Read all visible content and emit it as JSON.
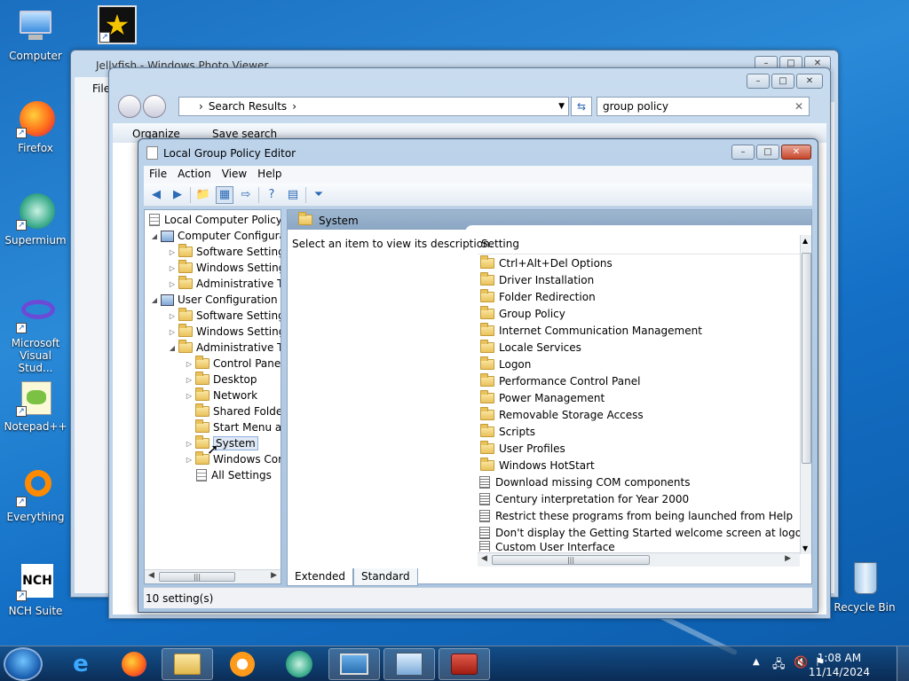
{
  "desktop": {
    "icons": [
      {
        "label": "Computer"
      },
      {
        "label": "Firefox"
      },
      {
        "label": "Supermium"
      },
      {
        "label": "Microsoft Visual Stud..."
      },
      {
        "label": "Notepad++"
      },
      {
        "label": "Everything"
      },
      {
        "label": "NCH Suite"
      },
      {
        "label": "Recycle Bin"
      }
    ]
  },
  "photo_viewer": {
    "title": "Jellyfish - Windows Photo Viewer",
    "menu_file": "File"
  },
  "explorer": {
    "breadcrumb": "Search Results",
    "search_value": "group policy",
    "organize": "Organize",
    "save_search": "Save search"
  },
  "gpe": {
    "title": "Local Group Policy Editor",
    "menu": [
      "File",
      "Action",
      "View",
      "Help"
    ],
    "tree": [
      {
        "label": "Local Computer Policy"
      },
      {
        "label": "Computer Configura"
      },
      {
        "label": "Software Settings"
      },
      {
        "label": "Windows Setting"
      },
      {
        "label": "Administrative Te"
      },
      {
        "label": "User Configuration"
      },
      {
        "label": "Software Settings"
      },
      {
        "label": "Windows Setting"
      },
      {
        "label": "Administrative Te"
      },
      {
        "label": "Control Panel"
      },
      {
        "label": "Desktop"
      },
      {
        "label": "Network"
      },
      {
        "label": "Shared Folder"
      },
      {
        "label": "Start Menu ar"
      },
      {
        "label": "System"
      },
      {
        "label": "Windows Cor"
      },
      {
        "label": "All Settings"
      }
    ],
    "header_title": "System",
    "description": "Select an item to view its description.",
    "column_setting": "Setting",
    "items": [
      "Ctrl+Alt+Del Options",
      "Driver Installation",
      "Folder Redirection",
      "Group Policy",
      "Internet Communication Management",
      "Locale Services",
      "Logon",
      "Performance Control Panel",
      "Power Management",
      "Removable Storage Access",
      "Scripts",
      "User Profiles",
      "Windows HotStart",
      "Download missing COM components",
      "Century interpretation for Year 2000",
      "Restrict these programs from being launched from Help",
      "Don't display the Getting Started welcome screen at logon",
      "Custom User Interface"
    ],
    "tabs": [
      "Extended",
      "Standard"
    ],
    "status": "10 setting(s)"
  },
  "taskbar": {
    "time": "1:08 AM",
    "date": "11/14/2024"
  }
}
